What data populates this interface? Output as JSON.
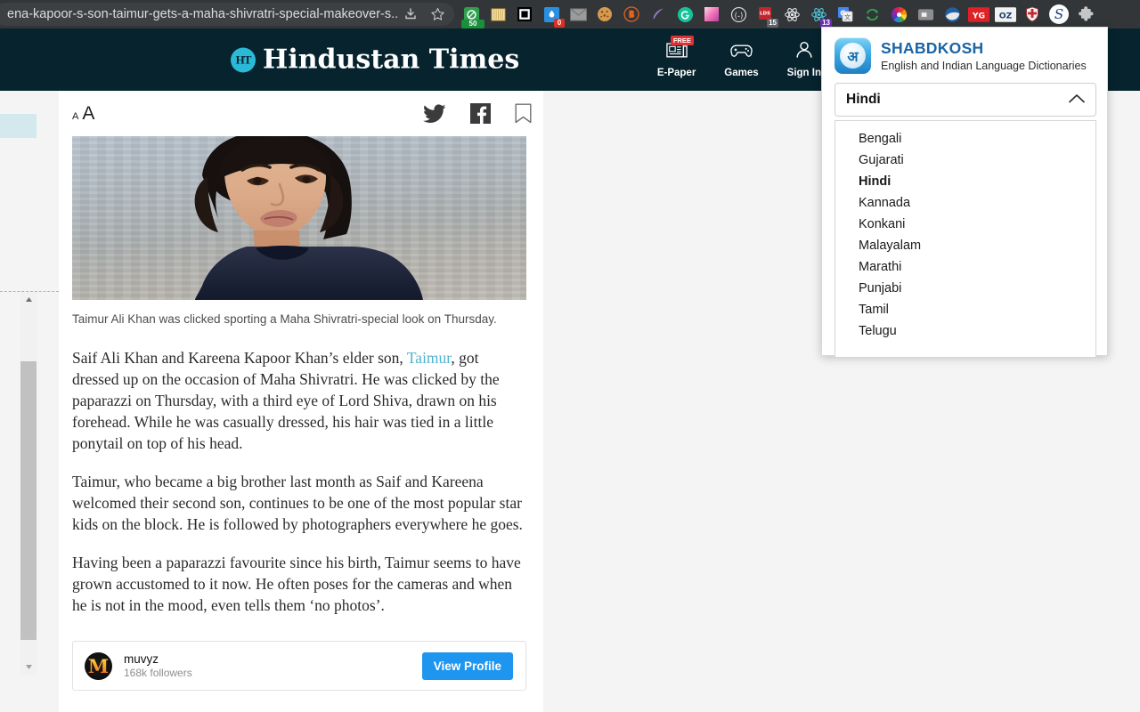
{
  "browser": {
    "url": "ena-kapoor-s-son-taimur-gets-a-maha-shivratri-special-makeover-s...",
    "omnibox_icons": [
      {
        "name": "download-icon"
      },
      {
        "name": "bookmark-star-icon"
      }
    ],
    "extensions": [
      {
        "name": "adblock-icon",
        "badge": "50",
        "badge_color": "#1a8f3c"
      },
      {
        "name": "notes-extension-icon",
        "badge": ""
      },
      {
        "name": "picture-in-picture-icon",
        "badge": ""
      },
      {
        "name": "pocket-extension-icon",
        "badge": "0",
        "badge_color": "#d93025"
      },
      {
        "name": "mail-icon",
        "badge": ""
      },
      {
        "name": "cookie-manager-icon",
        "badge": ""
      },
      {
        "name": "bitwarden-icon",
        "badge": ""
      },
      {
        "name": "feather-quill-icon",
        "badge": ""
      },
      {
        "name": "grammarly-icon",
        "badge": ""
      },
      {
        "name": "color-picker-icon",
        "badge": ""
      },
      {
        "name": "parentheses-extension-icon",
        "badge": ""
      },
      {
        "name": "red-badge-extension-icon",
        "badge": "15",
        "badge_color": "#5f6368"
      },
      {
        "name": "atom-extension-icon",
        "badge": ""
      },
      {
        "name": "react-devtools-icon",
        "badge": "13",
        "badge_color": "#6c2fb8"
      },
      {
        "name": "google-translate-icon",
        "badge": ""
      },
      {
        "name": "sync-refresh-icon",
        "badge": ""
      },
      {
        "name": "color-wheel-icon",
        "badge": ""
      },
      {
        "name": "window-extension-icon",
        "badge": ""
      },
      {
        "name": "pepsi-globe-icon",
        "badge": ""
      },
      {
        "name": "yg-extension-icon",
        "badge": "",
        "label": "YG"
      },
      {
        "name": "oz-extension-icon",
        "badge": "",
        "label": "OZ"
      },
      {
        "name": "crest-shield-icon",
        "badge": ""
      },
      {
        "name": "s-serif-extension-icon",
        "badge": "",
        "label": "S"
      },
      {
        "name": "puzzle-extensions-icon",
        "badge": ""
      }
    ]
  },
  "site": {
    "logo_mark": "HT",
    "logo_text": "Hindustan Times",
    "nav": [
      {
        "label": "E-Paper",
        "icon": "newspaper-icon",
        "badge": "FREE"
      },
      {
        "label": "Games",
        "icon": "gamepad-icon",
        "badge": ""
      },
      {
        "label": "Sign In",
        "icon": "user-icon",
        "badge": ""
      }
    ]
  },
  "article": {
    "font_size_small": "A",
    "font_size_large": "A",
    "share": [
      {
        "name": "twitter-share-icon"
      },
      {
        "name": "facebook-share-icon"
      },
      {
        "name": "bookmark-icon"
      }
    ],
    "caption": "Taimur Ali Khan was clicked sporting a Maha Shivratri-special look on Thursday.",
    "paragraphs": [
      {
        "before": "Saif Ali Khan and Kareena Kapoor Khan’s elder son, ",
        "link": "Taimur",
        "after": ", got dressed up on the occasion of Maha Shivratri. He was clicked by the paparazzi on Thursday, with a third eye of Lord Shiva, drawn on his forehead. While he was casually dressed, his hair was tied in a little ponytail on top of his head."
      },
      {
        "text": "Taimur, who became a big brother last month as Saif and Kareena welcomed their second son, continues to be one of the most popular star kids on the block. He is followed by photographers everywhere he goes."
      },
      {
        "text": "Having been a paparazzi favourite since his birth, Taimur seems to have grown accustomed to it now. He often poses for the cameras and when he is not in the mood, even tells them ‘no photos’."
      }
    ],
    "profile": {
      "avatar_letter": "M",
      "name": "muvyz",
      "followers": "168k followers",
      "button_label": "View Profile"
    }
  },
  "shabdkosh": {
    "logo_glyph": "अ",
    "title": "SHABDKOSH",
    "subtitle": "English and Indian Language Dictionaries",
    "selected_language": "Hindi",
    "languages": [
      "Bengali",
      "Gujarati",
      "Hindi",
      "Kannada",
      "Konkani",
      "Malayalam",
      "Marathi",
      "Punjabi",
      "Tamil",
      "Telugu"
    ]
  },
  "colors": {
    "ht_header": "#06232e",
    "ht_accent": "#2bb9d8",
    "link": "#4fb3cf",
    "brand_blue": "#1b64a5",
    "button_blue": "#1e96f0",
    "badge_red": "#e03131"
  }
}
